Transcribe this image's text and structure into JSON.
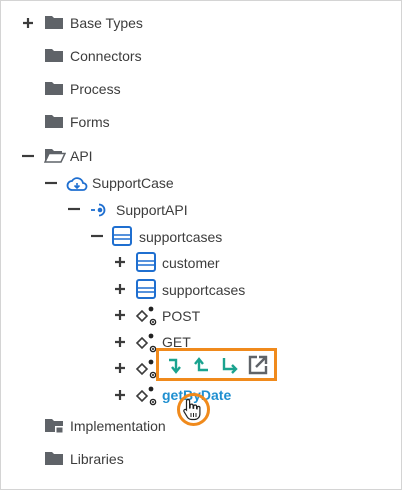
{
  "tree": {
    "base_types": {
      "label": "Base Types",
      "toggle": "+"
    },
    "connectors": {
      "label": "Connectors"
    },
    "process": {
      "label": "Process"
    },
    "forms": {
      "label": "Forms"
    },
    "api": {
      "label": "API",
      "toggle": "−"
    },
    "support_case": {
      "label": "SupportCase",
      "toggle": "−",
      "icon": "cloud-icon"
    },
    "support_api": {
      "label": "SupportAPI",
      "toggle": "−",
      "icon": "api-endpoint-icon"
    },
    "supportcases_resource": {
      "label": "supportcases",
      "toggle": "−",
      "icon": "resource-icon"
    },
    "customer": {
      "label": "customer",
      "toggle": "+",
      "icon": "resource-icon"
    },
    "supportcases_child": {
      "label": "supportcases",
      "toggle": "+",
      "icon": "resource-icon"
    },
    "post": {
      "label": "POST",
      "toggle": "+",
      "icon": "operation-icon"
    },
    "get": {
      "label": "GET",
      "toggle": "+",
      "icon": "operation-icon"
    },
    "op_hidden": {
      "toggle": "+",
      "icon": "operation-icon"
    },
    "get_by_date": {
      "label": "getByDate",
      "toggle": "+",
      "icon": "operation-icon"
    },
    "implementation": {
      "label": "Implementation"
    },
    "libraries": {
      "label": "Libraries"
    }
  },
  "action_bar": {
    "items": [
      "step-into-icon",
      "step-out-icon",
      "step-over-icon",
      "open-external-icon"
    ]
  },
  "colors": {
    "folder": "#5f6368",
    "accent_teal": "#1aa38f",
    "link_blue": "#1f8fd0",
    "highlight_orange": "#f08a1c",
    "text": "#3c3c3c"
  }
}
